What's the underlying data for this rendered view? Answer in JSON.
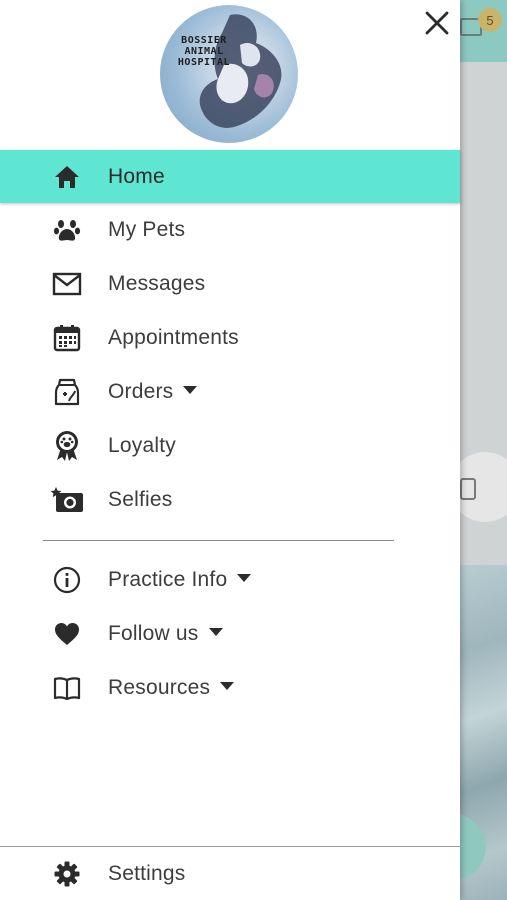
{
  "background": {
    "badge_count": "5"
  },
  "drawer": {
    "logo_text": [
      "BOSSIER",
      "ANIMAL",
      "HOSPITAL"
    ],
    "accent_color": "#5ee6d3",
    "main_items": [
      {
        "label": "Home",
        "icon": "home-icon",
        "active": true
      },
      {
        "label": "My Pets",
        "icon": "paw-icon"
      },
      {
        "label": "Messages",
        "icon": "envelope-icon"
      },
      {
        "label": "Appointments",
        "icon": "calendar-icon"
      },
      {
        "label": "Orders",
        "icon": "food-bag-icon",
        "dropdown": true
      },
      {
        "label": "Loyalty",
        "icon": "ribbon-badge-icon"
      },
      {
        "label": "Selfies",
        "icon": "camera-star-icon"
      }
    ],
    "secondary_items": [
      {
        "label": "Practice Info",
        "icon": "info-icon",
        "dropdown": true
      },
      {
        "label": "Follow us",
        "icon": "heart-icon",
        "dropdown": true
      },
      {
        "label": "Resources",
        "icon": "book-icon",
        "dropdown": true
      }
    ],
    "settings_label": "Settings"
  }
}
